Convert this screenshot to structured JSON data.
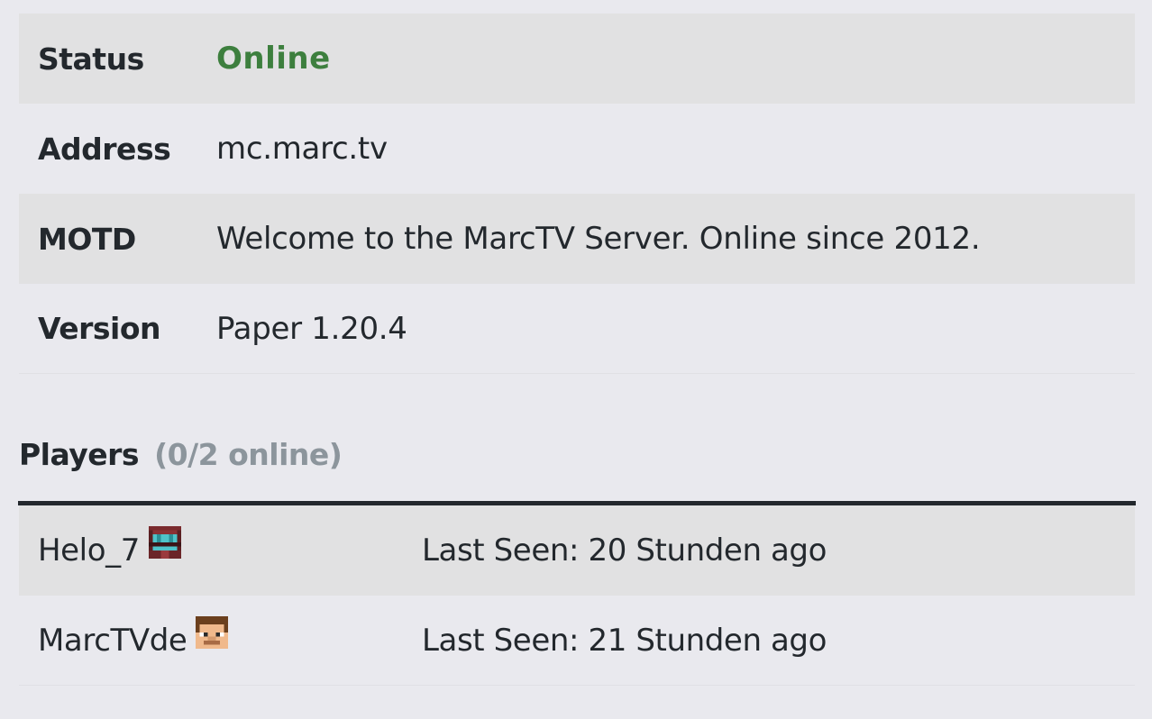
{
  "server_info": {
    "rows": [
      {
        "label": "Status",
        "value": "Online"
      },
      {
        "label": "Address",
        "value": "mc.marc.tv"
      },
      {
        "label": "MOTD",
        "value": "Welcome to the MarcTV Server. Online since 2012."
      },
      {
        "label": "Version",
        "value": "Paper 1.20.4"
      }
    ],
    "status_color": "#3d7f3e"
  },
  "players": {
    "heading": "Players",
    "count": "(0/2 online)",
    "list": [
      {
        "name": "Helo_7",
        "avatar": "helo-7-skin-avatar",
        "last_seen": "Last Seen: 20 Stunden ago"
      },
      {
        "name": "MarcTVde",
        "avatar": "marctvde-skin-avatar",
        "last_seen": "Last Seen: 21 Stunden ago"
      }
    ]
  }
}
